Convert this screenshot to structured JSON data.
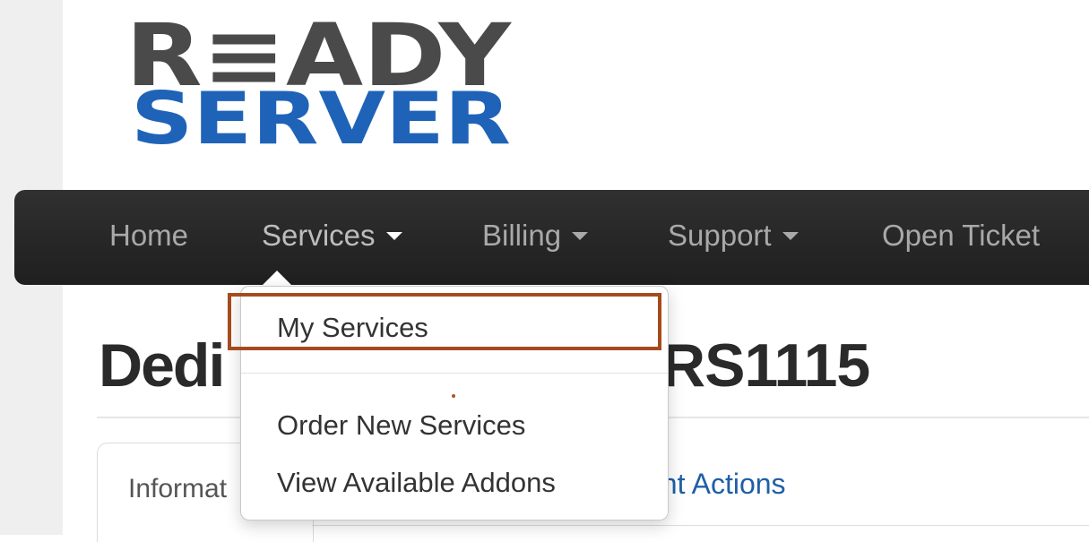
{
  "logo": {
    "line1": "R≡ADY",
    "line2": "SERVER",
    "colors": {
      "dark": "#4a4a4a",
      "blue": "#1f63b8"
    }
  },
  "nav": {
    "items": [
      {
        "label": "Home",
        "has_caret": false
      },
      {
        "label": "Services",
        "has_caret": true,
        "active": true
      },
      {
        "label": "Billing",
        "has_caret": true
      },
      {
        "label": "Support",
        "has_caret": true
      },
      {
        "label": "Open Ticket",
        "has_caret": false
      }
    ]
  },
  "page": {
    "title_left": "Dedi",
    "title_right": "RS1115"
  },
  "tabs": {
    "information": "Informat",
    "management": "ent Actions"
  },
  "dropdown": {
    "items": [
      {
        "label": "My Services",
        "highlighted": true
      },
      {
        "label": "Order New Services"
      },
      {
        "label": "View Available Addons"
      }
    ]
  },
  "colors": {
    "navbar": "#2a2a2a",
    "highlight_border": "#a64a1d",
    "link_blue": "#1f5fa8"
  }
}
